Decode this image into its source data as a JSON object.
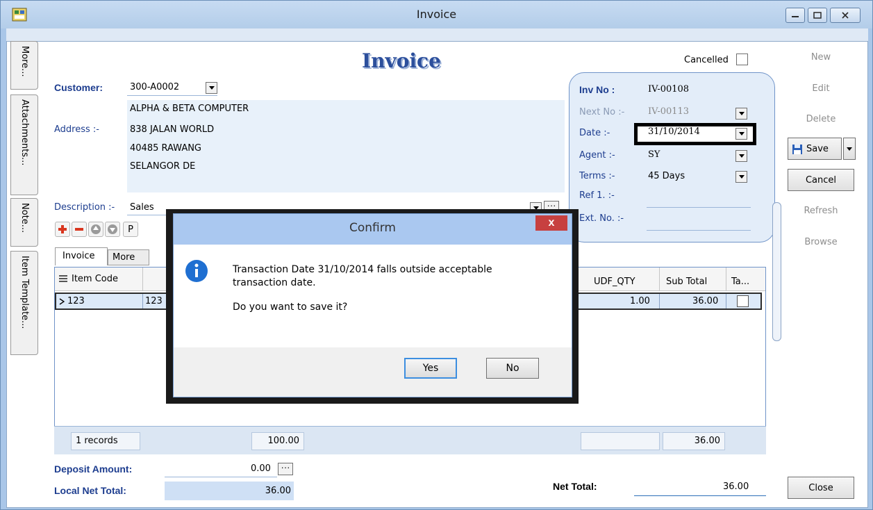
{
  "window": {
    "title": "Invoice"
  },
  "side_tabs": [
    "More...",
    "Attachments...",
    "Note...",
    "Item Template..."
  ],
  "form": {
    "heading": "Invoice",
    "cancelled_label": "Cancelled",
    "customer_label": "Customer:",
    "customer_code": "300-A0002",
    "customer_name": "ALPHA & BETA COMPUTER",
    "address_label": "Address :-",
    "address_lines": [
      "838 JALAN WORLD",
      "40485 RAWANG",
      "SELANGOR DE"
    ],
    "description_label": "Description :-",
    "description_value": "Sales",
    "toolbar_p": "P"
  },
  "info": {
    "inv_no_label": "Inv No :",
    "inv_no": "IV-00108",
    "next_no_label": "Next No :-",
    "next_no": "IV-00113",
    "date_label": "Date :-",
    "date": "31/10/2014",
    "agent_label": "Agent :-",
    "agent": "SY",
    "terms_label": "Terms :-",
    "terms": "45 Days",
    "ref1_label": "Ref 1. :-",
    "ext_no_label": "Ext. No. :-"
  },
  "actions": {
    "new": "New",
    "edit": "Edit",
    "delete": "Delete",
    "save": "Save",
    "cancel": "Cancel",
    "refresh": "Refresh",
    "browse": "Browse",
    "close": "Close"
  },
  "tabs": [
    "Invoice",
    "More"
  ],
  "grid": {
    "columns": {
      "item_code": "Item Code",
      "udf_qty": "UDF_QTY",
      "sub_total": "Sub Total",
      "tax": "Ta..."
    },
    "row": {
      "item_code": "123",
      "description_partial": "123",
      "udf_qty": "1.00",
      "sub_total": "36.00"
    },
    "footer": {
      "records": "1 records",
      "qty_total": "100.00",
      "sub_total": "36.00"
    }
  },
  "totals": {
    "deposit_label": "Deposit Amount:",
    "deposit_value": "0.00",
    "local_net_label": "Local Net Total:",
    "local_net_value": "36.00",
    "net_label": "Net Total:",
    "net_value": "36.00"
  },
  "dialog": {
    "title": "Confirm",
    "close_glyph": "x",
    "message_line1": "Transaction Date 31/10/2014 falls outside acceptable",
    "message_line2": "transaction date.",
    "question": "Do you want to save it?",
    "yes": "Yes",
    "no": "No"
  }
}
